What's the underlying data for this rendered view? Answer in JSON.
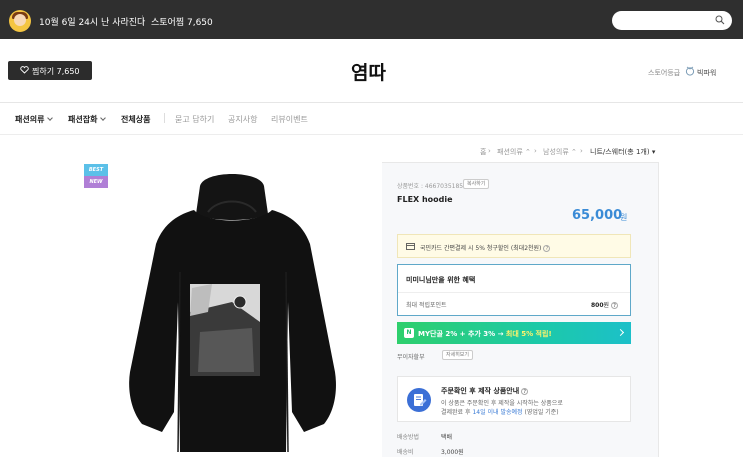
{
  "topbar": {
    "notice": "10월 6일 24시 난 사라진다",
    "store_points": "스토어찜 7,650"
  },
  "header": {
    "favorite_button": "찜하기 7,650",
    "store_name": "염따",
    "grade_label": "스토어등급",
    "grade_value": "빅파워"
  },
  "nav": {
    "items": [
      "패션의류",
      "패션잡화",
      "전체상품"
    ],
    "sub_items": [
      "묻고 답하기",
      "공지사항",
      "리뷰이벤트"
    ]
  },
  "breadcrumb": [
    "홈",
    "패션의류",
    "남성의류",
    "니트/스웨터(총 1개)"
  ],
  "product": {
    "badges": [
      "BEST",
      "NEW"
    ],
    "code_label": "상품번호 : 4667035185",
    "copy_label": "복사하기",
    "name": "FLEX hoodie",
    "price": "65,000",
    "price_unit": "원",
    "card_promo": "국민카드 간편결제 시 5% 청구할인 (최대2천원)",
    "benefit_title": "미미니님만을 위한 혜택",
    "benefit_label": "최대 적립포인트",
    "benefit_value": "800",
    "benefit_unit": "원",
    "my_banner_prefix": "MY단골 2% + 추가 3% →",
    "my_banner_highlight": "최대 5% 적립!",
    "my_banner_icon": "N",
    "installment_label": "무이자할부",
    "installment_button": "자세히보기",
    "order_title": "주문확인 후 제작 상품안내",
    "order_desc_1": "이 상품은 주문확인 후 제작을 시작하는 상품으로",
    "order_desc_2_prefix": "결제완료 후",
    "order_desc_2_highlight": "14일 이내 발송예정",
    "order_desc_2_suffix": "(영업일 기준)",
    "shipping_label": "배송방법",
    "shipping_value": "택배",
    "fee_label": "배송비",
    "fee_value": "3,000원"
  },
  "colors": {
    "topbar": "#2f2f2f",
    "price": "#3a8bd6",
    "benefit_border": "#5fa8c9",
    "my_banner": "#1cc9a8"
  }
}
